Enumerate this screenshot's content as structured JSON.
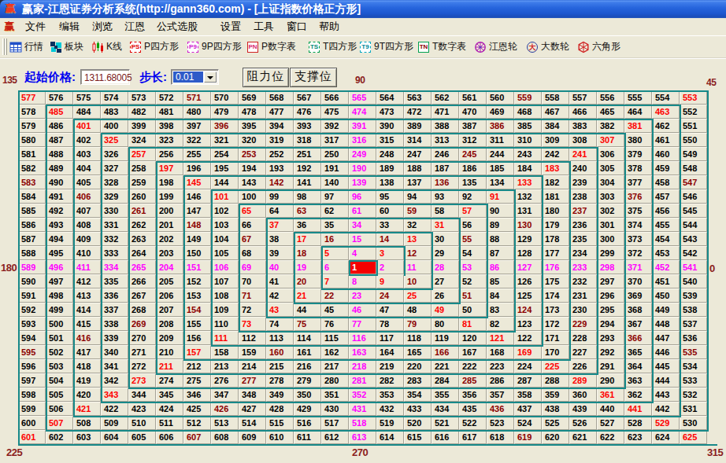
{
  "window": {
    "title": "赢家-江恩证券分析系统(http://gann360.com) - [上证指数价格正方形]",
    "icon_glyph": "赢",
    "icon": "app-logo-icon"
  },
  "menu": {
    "items": [
      {
        "label": "文件"
      },
      {
        "label": "编辑"
      },
      {
        "label": "浏览"
      },
      {
        "label": "江恩"
      },
      {
        "label": "公式选股"
      },
      {
        "label": "设置"
      },
      {
        "label": "工具"
      },
      {
        "label": "窗口"
      },
      {
        "label": "帮助"
      }
    ]
  },
  "toolbar": {
    "items": [
      {
        "label": "行情",
        "icon": "quotes-table-icon"
      },
      {
        "label": "板块",
        "icon": "sector-blocks-icon"
      },
      {
        "label": "K线",
        "icon": "candlestick-icon"
      },
      {
        "label": "P四方形",
        "icon": "ps-square-icon",
        "badge": "PS"
      },
      {
        "label": "9P四方形",
        "icon": "p9-square-icon",
        "badge": "P9"
      },
      {
        "label": "P数字表",
        "icon": "pn-table-icon",
        "badge": "PN"
      },
      {
        "label": "T四方形",
        "icon": "ts-square-icon",
        "badge": "TS"
      },
      {
        "label": "9T四方形",
        "icon": "t9-square-icon",
        "badge": "T9"
      },
      {
        "label": "T数字表",
        "icon": "tn-table-icon",
        "badge": "TN"
      },
      {
        "label": "江恩轮",
        "icon": "gann-wheel-icon"
      },
      {
        "label": "大数轮",
        "icon": "big-number-wheel-icon",
        "badge": "大"
      },
      {
        "label": "六角形",
        "icon": "hexagon-icon"
      }
    ]
  },
  "controls": {
    "start_price_label": "起始价格:",
    "start_price_value": "1311.68005",
    "step_label": "步长:",
    "step_value": "0.01",
    "resistance_label": "阻力位",
    "support_label": "支撑位"
  },
  "angle_labels": {
    "top_left": "135",
    "top_center": "90",
    "top_right": "45",
    "middle_left": "180",
    "middle_right": "0",
    "bottom_left": "225",
    "bottom_center": "270",
    "bottom_right": "315"
  },
  "chart_data": {
    "type": "table",
    "subtype": "gann-square-of-nine",
    "title": "上证指数价格正方形",
    "size": 25,
    "min_value": 1,
    "max_value": 625,
    "spiral": "counterclockwise-from-center-starting-right",
    "highlight_value": 1,
    "colors": {
      "cross": "#FF00FF",
      "diagonal": "#FF0000",
      "octant_mid": "#8B0000",
      "default": "#000000",
      "highlight_bg": "#F40000",
      "highlight_text": "#FFFFFF",
      "ring_border": "#178989",
      "label": "#8B1E1E"
    },
    "rows": [
      [
        577,
        576,
        575,
        574,
        573,
        572,
        571,
        570,
        569,
        568,
        567,
        566,
        565,
        564,
        563,
        562,
        561,
        560,
        559,
        558,
        557,
        556,
        555,
        554,
        553
      ],
      [
        578,
        485,
        484,
        483,
        482,
        481,
        480,
        479,
        478,
        477,
        476,
        475,
        474,
        473,
        472,
        471,
        470,
        469,
        468,
        467,
        466,
        465,
        464,
        463,
        552
      ],
      [
        579,
        486,
        401,
        400,
        399,
        398,
        397,
        396,
        395,
        394,
        393,
        392,
        391,
        390,
        389,
        388,
        387,
        386,
        385,
        384,
        383,
        382,
        381,
        462,
        551
      ],
      [
        580,
        487,
        402,
        325,
        324,
        323,
        322,
        321,
        320,
        319,
        318,
        317,
        316,
        315,
        314,
        313,
        312,
        311,
        310,
        309,
        308,
        307,
        380,
        461,
        550
      ],
      [
        581,
        488,
        403,
        326,
        257,
        256,
        255,
        254,
        253,
        252,
        251,
        250,
        249,
        248,
        247,
        246,
        245,
        244,
        243,
        242,
        241,
        306,
        379,
        460,
        549
      ],
      [
        582,
        489,
        404,
        327,
        258,
        197,
        196,
        195,
        194,
        193,
        192,
        191,
        190,
        189,
        188,
        187,
        186,
        185,
        184,
        183,
        240,
        305,
        378,
        459,
        548
      ],
      [
        583,
        490,
        405,
        328,
        259,
        198,
        145,
        144,
        143,
        142,
        141,
        140,
        139,
        138,
        137,
        136,
        135,
        134,
        133,
        182,
        239,
        304,
        377,
        458,
        547
      ],
      [
        584,
        491,
        406,
        329,
        260,
        199,
        146,
        101,
        100,
        99,
        98,
        97,
        96,
        95,
        94,
        93,
        92,
        91,
        132,
        181,
        238,
        303,
        376,
        457,
        546
      ],
      [
        585,
        492,
        407,
        330,
        261,
        200,
        147,
        102,
        65,
        64,
        63,
        62,
        61,
        60,
        59,
        58,
        57,
        90,
        131,
        180,
        237,
        302,
        375,
        456,
        545
      ],
      [
        586,
        493,
        408,
        331,
        262,
        201,
        148,
        103,
        66,
        37,
        36,
        35,
        34,
        33,
        32,
        31,
        56,
        89,
        130,
        179,
        236,
        301,
        374,
        455,
        544
      ],
      [
        587,
        494,
        409,
        332,
        263,
        202,
        149,
        104,
        67,
        38,
        17,
        16,
        15,
        14,
        13,
        30,
        55,
        88,
        129,
        178,
        235,
        300,
        373,
        454,
        543
      ],
      [
        588,
        495,
        410,
        333,
        264,
        203,
        150,
        105,
        68,
        39,
        18,
        5,
        4,
        3,
        12,
        29,
        54,
        87,
        128,
        177,
        234,
        299,
        372,
        453,
        542
      ],
      [
        589,
        496,
        411,
        334,
        265,
        204,
        151,
        106,
        69,
        40,
        19,
        6,
        1,
        2,
        11,
        28,
        53,
        86,
        127,
        176,
        233,
        298,
        371,
        452,
        541
      ],
      [
        590,
        497,
        412,
        335,
        266,
        205,
        152,
        107,
        70,
        41,
        20,
        7,
        8,
        9,
        10,
        27,
        52,
        85,
        126,
        175,
        232,
        297,
        370,
        451,
        540
      ],
      [
        591,
        498,
        413,
        336,
        267,
        206,
        153,
        108,
        71,
        42,
        21,
        22,
        23,
        24,
        25,
        26,
        51,
        84,
        125,
        174,
        231,
        296,
        369,
        450,
        539
      ],
      [
        592,
        499,
        414,
        337,
        268,
        207,
        154,
        109,
        72,
        43,
        44,
        45,
        46,
        47,
        48,
        49,
        50,
        83,
        124,
        173,
        230,
        295,
        368,
        449,
        538
      ],
      [
        593,
        500,
        415,
        338,
        269,
        208,
        155,
        110,
        73,
        74,
        75,
        76,
        77,
        78,
        79,
        80,
        81,
        82,
        123,
        172,
        229,
        294,
        367,
        448,
        537
      ],
      [
        594,
        501,
        416,
        339,
        270,
        209,
        156,
        111,
        112,
        113,
        114,
        115,
        116,
        117,
        118,
        119,
        120,
        121,
        122,
        171,
        228,
        293,
        366,
        447,
        536
      ],
      [
        595,
        502,
        417,
        340,
        271,
        210,
        157,
        158,
        159,
        160,
        161,
        162,
        163,
        164,
        165,
        166,
        167,
        168,
        169,
        170,
        227,
        292,
        365,
        446,
        535
      ],
      [
        596,
        503,
        418,
        341,
        272,
        211,
        212,
        213,
        214,
        215,
        216,
        217,
        218,
        219,
        220,
        221,
        222,
        223,
        224,
        225,
        226,
        291,
        364,
        445,
        534
      ],
      [
        597,
        504,
        419,
        342,
        273,
        274,
        275,
        276,
        277,
        278,
        279,
        280,
        281,
        282,
        283,
        284,
        285,
        286,
        287,
        288,
        289,
        290,
        363,
        444,
        533
      ],
      [
        598,
        505,
        420,
        343,
        344,
        345,
        346,
        347,
        348,
        349,
        350,
        351,
        352,
        353,
        354,
        355,
        356,
        357,
        358,
        359,
        360,
        361,
        362,
        443,
        532
      ],
      [
        599,
        506,
        421,
        422,
        423,
        424,
        425,
        426,
        427,
        428,
        429,
        430,
        431,
        432,
        433,
        434,
        435,
        436,
        437,
        438,
        439,
        440,
        441,
        442,
        531
      ],
      [
        600,
        507,
        508,
        509,
        510,
        511,
        512,
        513,
        514,
        515,
        516,
        517,
        518,
        519,
        520,
        521,
        522,
        523,
        524,
        525,
        526,
        527,
        528,
        529,
        530
      ],
      [
        601,
        602,
        603,
        604,
        605,
        606,
        607,
        608,
        609,
        610,
        611,
        612,
        613,
        614,
        615,
        616,
        617,
        618,
        619,
        620,
        621,
        622,
        623,
        624,
        625
      ]
    ]
  }
}
